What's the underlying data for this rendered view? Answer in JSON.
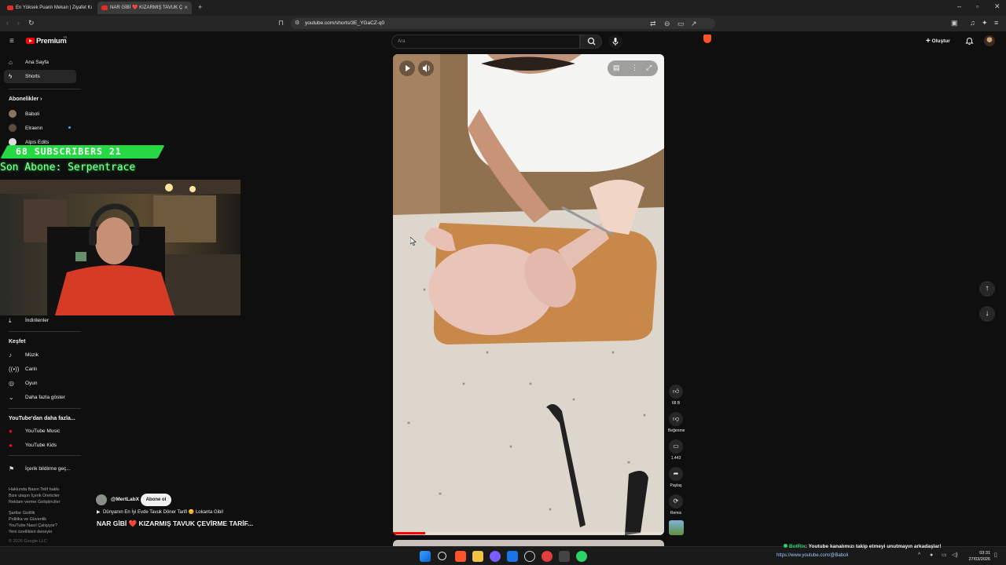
{
  "browser": {
    "tabs": [
      {
        "title": "En Yüksek Puanlı Mekan | Ziyafet Kı",
        "active": false
      },
      {
        "title": "NAR GİBİ ❤️ KIZARMIŞ TAVUK Ç",
        "active": true
      }
    ],
    "new_tab": "+",
    "url": "youtube.com/shorts/3E_YGaCZ-q0"
  },
  "youtube": {
    "brand": "Premium",
    "brand_sup": "TR",
    "search_placeholder": "Ara",
    "create_label": "Oluştur",
    "sidebar": {
      "home": "Ana Sayfa",
      "shorts": "Shorts",
      "subscriptions_title": "Abonelikler",
      "subscriptions": [
        "Baboli",
        "Elraenn",
        "Alpis Edits"
      ],
      "downloads": "İndirilenler",
      "explore_title": "Keşfet",
      "explore": [
        "Müzik",
        "Canlı",
        "Oyun",
        "Daha fazla göster"
      ],
      "more_title": "YouTube'dan daha fazla...",
      "more": [
        "YouTube Music",
        "YouTube Kids"
      ],
      "report": "İçerik bildirme geç...",
      "footer1": "Hakkında  Basın  Telif hakkı",
      "footer2": "Bize ulaşın  İçerik Üreticiler",
      "footer3": "Reklam verme  Geliştiriciler",
      "footer4": "Şartlar  Gizlilik",
      "footer5": "Politika ve Güvenlik",
      "footer6": "YouTube Nasıl Çalışıyor?",
      "footer7": "Yeni özellikleri deneyin",
      "copyright": "© 2026 Google LLC"
    },
    "short": {
      "channel": "@MertLabX",
      "subscribe": "Abone ol",
      "playlist": "Dünyanın En İyi Evde Tavuk Döner Tarifi 😋 Lokanta Gibi!",
      "title": "NAR GİBİ ❤️ KIZARMIŞ TAVUK ÇEVİRME TARİF...",
      "likes": "68 B",
      "dislike": "Beğenme",
      "comments": "1.443",
      "share": "Paylaş",
      "remix": "Remix",
      "progress": 0.12
    }
  },
  "stream_overlay": {
    "subscribers_label": "68  SUBSCRIBERS  21",
    "last_sub": "Son Abone: Serpentrace"
  },
  "taskbar": {
    "bot_name": "BotRix",
    "bot_message": ": Youtube kanalımızı takip etmeyi unutmayın arkadaşlar!",
    "bot_link": "https://www.youtube.com/@Baboli",
    "time": "03:31",
    "date": "27/03/2026"
  },
  "colors": {
    "brand": "#ff0000",
    "overlay_green": "#27d845",
    "background": "#0f0f0f"
  }
}
